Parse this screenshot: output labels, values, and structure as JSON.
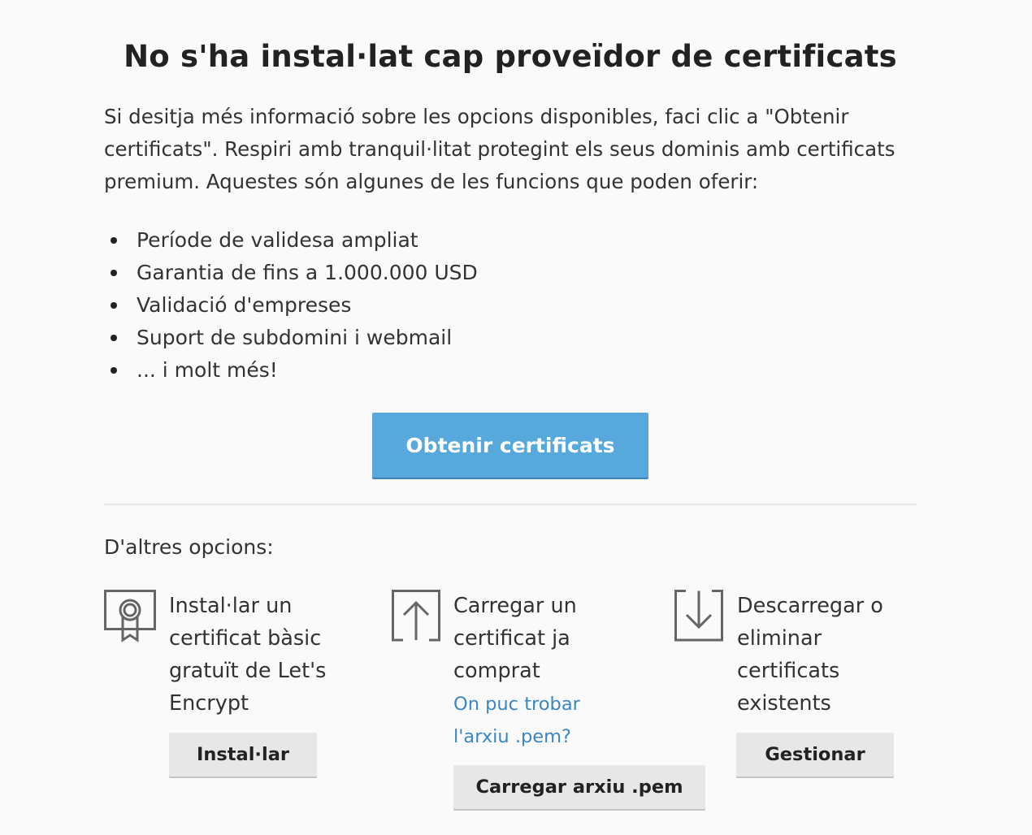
{
  "title": "No s'ha instal·lat cap proveïdor de certificats",
  "intro": "Si desitja més informació sobre les opcions disponibles, faci clic a \"Obtenir certificats\". Respiri amb tranquil·litat protegint els seus dominis amb certificats premium. Aquestes són algunes de les funcions que poden oferir:",
  "features": [
    "Període de validesa ampliat",
    "Garantia de fins a 1.000.000 USD",
    "Validació d'empreses",
    "Suport de subdomini i webmail",
    "... i molt més!"
  ],
  "primary_button": "Obtenir certificats",
  "other_options_label": "D'altres opcions:",
  "options": {
    "install": {
      "icon": "certificate-ribbon-icon",
      "text": "Instal·lar un certificat bàsic gratuït de Let's Encrypt",
      "button": "Instal·lar"
    },
    "upload": {
      "icon": "upload-arrow-icon",
      "text": "Carregar un certificat ja comprat",
      "link": "On puc trobar l'arxiu .pem?",
      "button": "Carregar arxiu .pem"
    },
    "manage": {
      "icon": "download-arrow-icon",
      "text": "Descarregar o eliminar certificats existents",
      "button": "Gestionar"
    }
  },
  "colors": {
    "primary": "#57a8dc",
    "link": "#3a87bf",
    "secondary_button": "#e7e7e7",
    "background": "#fafafa"
  }
}
